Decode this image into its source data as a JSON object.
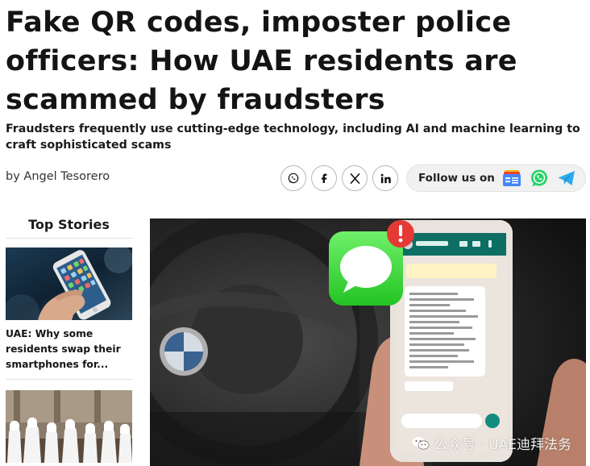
{
  "article": {
    "headline": "Fake QR codes, imposter police officers: How UAE residents are scammed by fraudsters",
    "subheadline": "Fraudsters frequently use cutting-edge technology, including AI and machine learning to craft sophisticated scams",
    "byline": "by Angel Tesorero"
  },
  "share": {
    "icons": [
      "whatsapp-icon",
      "facebook-icon",
      "x-icon",
      "linkedin-icon"
    ]
  },
  "follow": {
    "label": "Follow us on",
    "icons": [
      "google-news-icon",
      "whatsapp-icon",
      "telegram-icon"
    ]
  },
  "sidebar": {
    "title": "Top Stories",
    "stories": [
      {
        "title": "UAE: Why some residents swap their smartphones for..."
      },
      {
        "title": ""
      }
    ]
  },
  "hero": {
    "watermark": "公众号 · UAE迪拜法务"
  },
  "colors": {
    "whatsapp": "#25D366",
    "telegram": "#2AABEE",
    "notification": "#E53935"
  }
}
